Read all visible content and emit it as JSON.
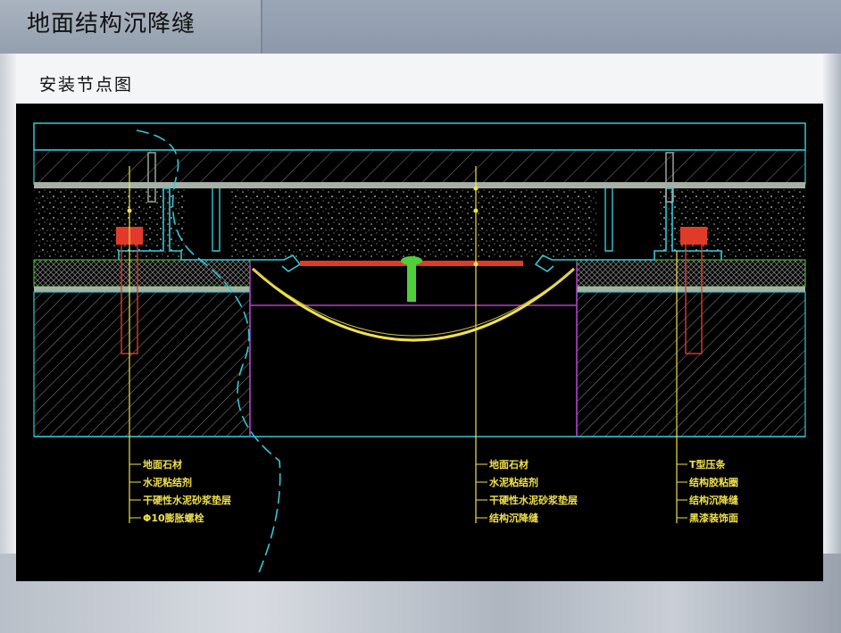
{
  "slide": {
    "title": "地面结构沉降缝",
    "subtitle": "安装节点图"
  },
  "diagram": {
    "colors": {
      "background": "#000000",
      "outline": "#35c7d6",
      "stone": "#a7b0a6",
      "leader": "#f0e24a",
      "accent_red": "#e23a2a",
      "accent_green": "#4fcf3a",
      "accent_magenta": "#b43fc9"
    },
    "labels_left": [
      "地面石材",
      "水泥粘结剂",
      "干硬性水泥砂浆垫层",
      "Φ10膨胀螺栓"
    ],
    "labels_center": [
      "地面石材",
      "水泥粘结剂",
      "干硬性水泥砂浆垫层",
      "结构沉降缝"
    ],
    "labels_right": [
      "T型压条",
      "结构胶粘圈",
      "结构沉降缝",
      "黑漆装饰面"
    ]
  }
}
